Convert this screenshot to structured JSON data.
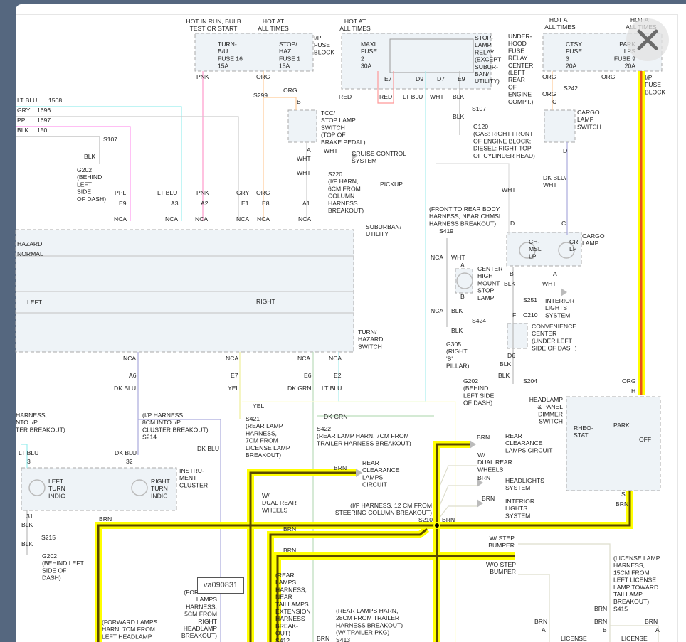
{
  "viewer": {
    "close_label": "close",
    "close_icon": "close-x-icon",
    "image_id": "va090831"
  },
  "colors": {
    "highlight": "#ffff00",
    "brn_core": "#5b4a00",
    "org_core": "#e8521a",
    "box_fill": "#eef3f7",
    "frame": "#55677f"
  },
  "labels": [
    [
      "HOT IN RUN, BULB",
      "TEST OR START"
    ],
    [
      "HOT AT",
      "ALL TIMES"
    ],
    [
      "TURN-",
      "B/U",
      "FUSE 16",
      "15A"
    ],
    [
      "STOP/",
      "HAZ",
      "FUSE 1",
      "15A"
    ],
    [
      "I/P",
      "FUSE",
      "BLOCK"
    ],
    [
      "HOT AT",
      "ALL TIMES"
    ],
    [
      "MAXI",
      "FUSE",
      "2",
      "30A"
    ],
    [
      "STOP-",
      "LAMP",
      "RELAY",
      "(EXCEPT",
      "SUBUR-",
      "BAN/",
      "UTILITY)"
    ],
    [
      "UNDER-",
      "HOOD",
      "FUSE",
      "RELAY",
      "CENTER",
      "(LEFT",
      "REAR",
      "OF",
      "ENGINE",
      "COMPT.)"
    ],
    [
      "HOT AT",
      "ALL TIMES"
    ],
    [
      "CTSY",
      "FUSE",
      "3",
      "20A"
    ],
    [
      "PARK",
      "LPS",
      "FUSE 9",
      "20A"
    ],
    [
      "HOT AT",
      "ALL TIMES"
    ],
    [
      "I/P",
      "FUSE",
      "BLOCK"
    ],
    [
      "PNK"
    ],
    [
      "ORG"
    ],
    [
      "E7"
    ],
    [
      "D9"
    ],
    [
      "D7"
    ],
    [
      "E9"
    ],
    [
      "RED"
    ],
    [
      "RED"
    ],
    [
      "LT BLU"
    ],
    [
      "WHT"
    ],
    [
      "BLK"
    ],
    [
      "ORG"
    ],
    [
      "ORG"
    ],
    [
      "S242"
    ],
    [
      "ORG"
    ],
    [
      "C"
    ],
    [
      "S107"
    ],
    [
      "BLK"
    ],
    [
      "G120",
      "(GAS: RIGHT FRONT",
      "OF ENGINE BLOCK;",
      "DIESEL: RIGHT TOP",
      "OF CYLINDER HEAD)"
    ],
    [
      "CARGO",
      "LAMP",
      "SWITCH"
    ],
    [
      "D"
    ],
    [
      "DK BLU/",
      "WHT"
    ],
    [
      "LT BLU"
    ],
    [
      "1508"
    ],
    [
      "GRY"
    ],
    [
      "1696"
    ],
    [
      "PPL"
    ],
    [
      "1697"
    ],
    [
      "BLK"
    ],
    [
      "150"
    ],
    [
      "S107"
    ],
    [
      "BLK"
    ],
    [
      "G202",
      "(BEHIND",
      "LEFT",
      "SIDE",
      "OF DASH)"
    ],
    [
      "S299"
    ],
    [
      "ORG"
    ],
    [
      "B"
    ],
    [
      "TCC/",
      "STOP LAMP",
      "SWITCH",
      "(TOP OF",
      "BRAKE PEDAL)"
    ],
    [
      "A"
    ],
    [
      "WHT"
    ],
    [
      "WHT"
    ],
    [
      "CRUISE CONTROL",
      "SYSTEM"
    ],
    [
      "WHT"
    ],
    [
      "S220",
      "(I/P HARN,",
      "6CM FROM",
      "COLUMN",
      "HARNESS",
      "BREAKOUT)"
    ],
    [
      "PICKUP"
    ],
    [
      "WHT"
    ],
    [
      "SUBURBAN/",
      "UTILITY"
    ],
    [
      "(FRONT TO REAR BODY",
      "HARNESS, NEAR CHMSL",
      "HARNESS BREAKOUT)"
    ],
    [
      "S419"
    ],
    [
      "D"
    ],
    [
      "C"
    ],
    [
      "CARGO",
      "LAMP"
    ],
    [
      "CH-",
      "MSL",
      "LP"
    ],
    [
      "CR",
      "LP"
    ],
    [
      "PPL"
    ],
    [
      "LT BLU"
    ],
    [
      "PNK"
    ],
    [
      "GRY"
    ],
    [
      "ORG"
    ],
    [
      "E9"
    ],
    [
      "A3"
    ],
    [
      "A2"
    ],
    [
      "E1"
    ],
    [
      "E8"
    ],
    [
      "A1"
    ],
    [
      "NCA"
    ],
    [
      "NCA"
    ],
    [
      "NCA"
    ],
    [
      "NCA"
    ],
    [
      "NCA"
    ],
    [
      "NCA"
    ],
    [
      "HAZARD"
    ],
    [
      "NORMAL"
    ],
    [
      "LEFT"
    ],
    [
      "RIGHT"
    ],
    [
      "TURN/",
      "HAZARD",
      "SWITCH"
    ],
    [
      "NCA"
    ],
    [
      "WHT"
    ],
    [
      "A"
    ],
    [
      "B"
    ],
    [
      "CENTER",
      "HIGH",
      "MOUNT",
      "STOP",
      "LAMP"
    ],
    [
      "B"
    ],
    [
      "A"
    ],
    [
      "BLK"
    ],
    [
      "WHT"
    ],
    [
      "INTERIOR",
      "LIGHTS",
      "SYSTEM"
    ],
    [
      "S251"
    ],
    [
      "F"
    ],
    [
      "C210"
    ],
    [
      "NCA"
    ],
    [
      "BLK"
    ],
    [
      "S424"
    ],
    [
      "BLK"
    ],
    [
      "CONVENIENCE",
      "CENTER",
      "(UNDER LEFT",
      "SIDE OF DASH)"
    ],
    [
      "G305",
      "(RIGHT",
      "'B'",
      "PILLAR)"
    ],
    [
      "D6"
    ],
    [
      "BLK"
    ],
    [
      "BLK"
    ],
    [
      "S204"
    ],
    [
      "G202",
      "(BEHIND",
      "LEFT SIDE",
      "OF DASH)"
    ],
    [
      "NCA"
    ],
    [
      "NCA"
    ],
    [
      "NCA"
    ],
    [
      "NCA"
    ],
    [
      "A6"
    ],
    [
      "E7"
    ],
    [
      "E6"
    ],
    [
      "E2"
    ],
    [
      "DK BLU"
    ],
    [
      "YEL"
    ],
    [
      "DK GRN"
    ],
    [
      "LT BLU"
    ],
    [
      "ORG"
    ],
    [
      "H"
    ],
    [
      "HEADLAMP",
      "& PANEL",
      "DIMMER",
      "SWITCH"
    ],
    [
      "RHEO-",
      "STAT"
    ],
    [
      "PARK"
    ],
    [
      "OFF"
    ],
    [
      "YEL"
    ],
    [
      "S421",
      "(REAR LAMP",
      "HARNESS,",
      "7CM FROM",
      "LICENSE LAMP",
      "BREAKOUT)"
    ],
    [
      "DK GRN"
    ],
    [
      "S422",
      "(REAR LAMP HARN, 7CM FROM",
      "TRAILER HARNESS BREAKOUT)"
    ],
    [
      "HARNESS,",
      "NTO I/P",
      "TER BREAKOUT)"
    ],
    [
      "(I/P HARNESS,",
      "8CM INTO I/P",
      "CLUSTER BREAKOUT)",
      "S214"
    ],
    [
      "DK BLU"
    ],
    [
      "LT BLU"
    ],
    [
      "3"
    ],
    [
      "DK BLU"
    ],
    [
      "32"
    ],
    [
      "INSTRU-",
      "MENT",
      "CLUSTER"
    ],
    [
      "LEFT",
      "TURN",
      "INDIC"
    ],
    [
      "RIGHT",
      "TURN",
      "INDIC"
    ],
    [
      "31"
    ],
    [
      "BLK"
    ],
    [
      "BRN"
    ],
    [
      "S215"
    ],
    [
      "BLK"
    ],
    [
      "G202",
      "(BEHIND LEFT",
      "SIDE OF",
      "DASH)"
    ],
    [
      "BRN"
    ],
    [
      "REAR",
      "CLEARANCE",
      "LAMPS CIRCUIT"
    ],
    [
      "W/",
      "DUAL REAR",
      "WHEELS"
    ],
    [
      "BRN"
    ],
    [
      "HEADLIGHTS",
      "SYSTEM"
    ],
    [
      "BRN"
    ],
    [
      "INTERIOR",
      "LIGHTS",
      "SYSTEM"
    ],
    [
      "BRN"
    ],
    [
      "REAR",
      "CLEARANCE",
      "LAMPS",
      "CIRCUIT"
    ],
    [
      "W/",
      "DUAL REAR",
      "WHEELS"
    ],
    [
      "(I/P HARNESS, 12 CM FROM",
      "STEERING COLUMN BREAKOUT)"
    ],
    [
      "S210"
    ],
    [
      "BRN"
    ],
    [
      "BRN"
    ],
    [
      "BRN"
    ],
    [
      "S"
    ],
    [
      "BRN"
    ],
    [
      "W/ STEP",
      "BUMPER"
    ],
    [
      "W/O STEP",
      "BUMPER"
    ],
    [
      "(LICENSE LAMP",
      "HARNESS,",
      "15CM FROM",
      "LEFT LICENSE",
      "LAMP TOWARD",
      "TAILLAMP",
      "BREAKOUT)",
      "S415"
    ],
    [
      "BRN"
    ],
    [
      "BRN"
    ],
    [
      "A"
    ],
    [
      "BRN"
    ],
    [
      "B"
    ],
    [
      "BRN"
    ],
    [
      "A"
    ],
    [
      "LICENSE"
    ],
    [
      "LICENSE"
    ],
    [
      "(FORWARD",
      "LAMPS",
      "HARNESS,",
      "5CM FROM",
      "RIGHT",
      "HEADLAMP",
      "BREAKOUT)"
    ],
    [
      "(FORWARD LAMPS",
      "HARN, 7CM FROM",
      "LEFT HEADLAMP"
    ],
    [
      "(REAR",
      "LAMPS",
      "HARNESS,",
      "NEAR",
      "TAILLAMPS",
      "EXTENSION",
      "HARNESS",
      "BREAK-",
      "OUT)",
      "S412"
    ],
    [
      "(REAR LAMPS HARN,",
      "28CM FROM TRAILER",
      "HARNESS BREAKOUT)",
      "(W/ TRAILER PKG)",
      "S413"
    ],
    [
      "BRN"
    ]
  ]
}
